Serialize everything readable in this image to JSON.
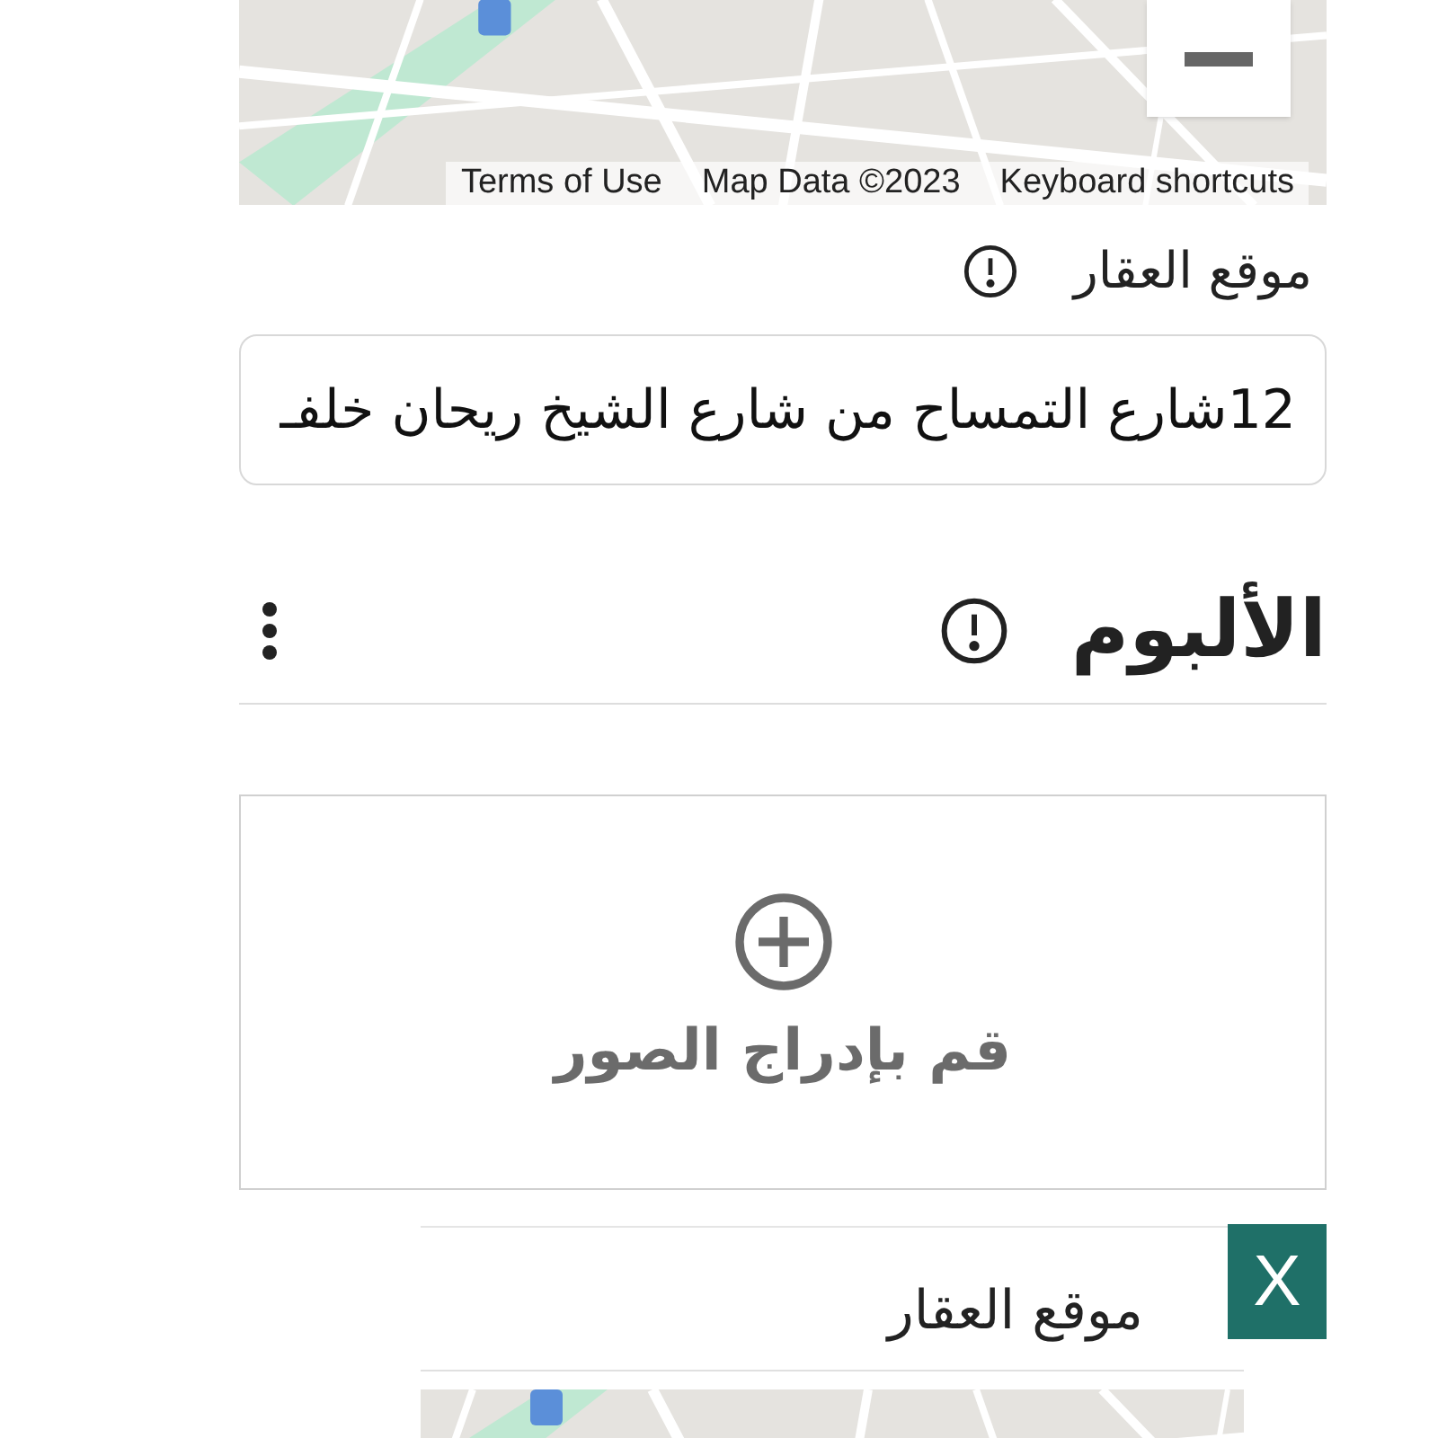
{
  "map": {
    "attribution": [
      "Keyboard shortcuts",
      "Map Data ©2023",
      "Terms of Use"
    ]
  },
  "location": {
    "label": "موقع العقار",
    "value": "12شارع التمساح من شارع الشيخ ريحان خلفـ"
  },
  "album": {
    "title": "الألبوم",
    "upload_label": "قم بإدراج الصور"
  },
  "dialog": {
    "title": "موقع العقار",
    "close_button": "X"
  }
}
